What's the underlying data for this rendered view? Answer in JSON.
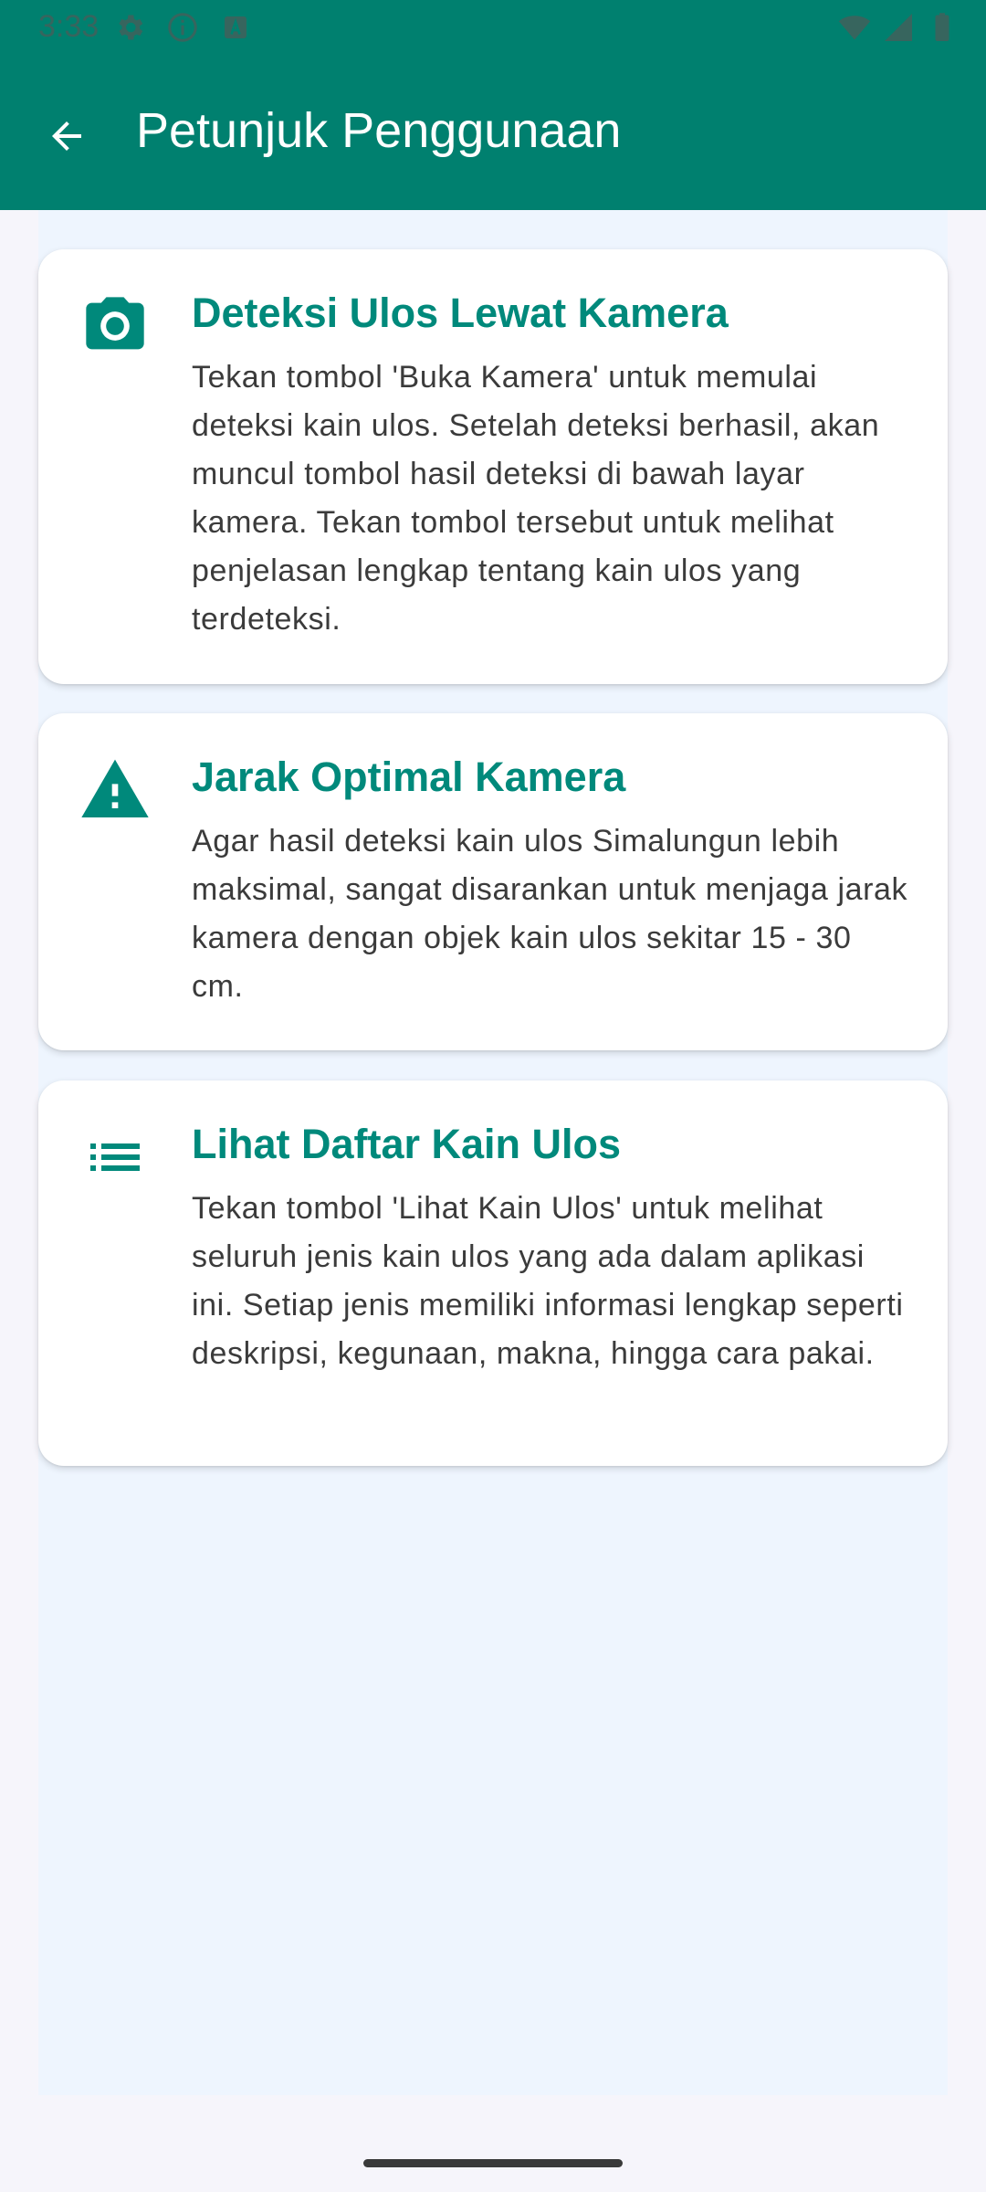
{
  "status_bar": {
    "time": "3:33",
    "left_icons": [
      "settings-icon",
      "info-icon",
      "app-a-icon"
    ],
    "right_icons": [
      "wifi-icon",
      "signal-icon",
      "battery-icon"
    ]
  },
  "app_bar": {
    "title": "Petunjuk Penggunaan",
    "back_icon": "arrow-back-icon",
    "color": "#00806f"
  },
  "cards": [
    {
      "icon": "camera-icon",
      "title": "Deteksi Ulos Lewat Kamera",
      "body": "Tekan tombol 'Buka Kamera' untuk memulai deteksi kain ulos. Setelah deteksi berhasil, akan muncul tombol hasil deteksi di bawah layar kamera. Tekan tombol tersebut untuk melihat penjelasan lengkap tentang kain ulos yang terdeteksi."
    },
    {
      "icon": "warning-icon",
      "title": "Jarak Optimal Kamera",
      "body": "Agar hasil deteksi kain ulos Simalungun lebih maksimal, sangat disarankan untuk menjaga jarak kamera dengan objek kain ulos sekitar 15 - 30 cm."
    },
    {
      "icon": "list-icon",
      "title": "Lihat Daftar Kain Ulos",
      "body": "Tekan tombol 'Lihat Kain Ulos' untuk melihat seluruh jenis kain ulos yang ada dalam aplikasi ini. Setiap jenis memiliki informasi lengkap seperti deskripsi, kegunaan, makna, hingga cara pakai."
    }
  ],
  "accent_color": "#00897b"
}
